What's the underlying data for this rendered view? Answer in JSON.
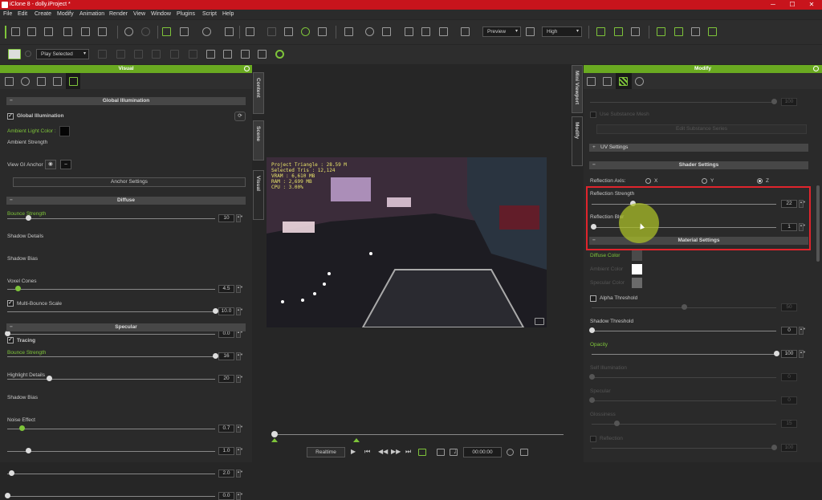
{
  "window": {
    "title": "iClone 8 - dolly.iProject *",
    "min": "─",
    "max": "☐",
    "close": "✕"
  },
  "menu": [
    "File",
    "Edit",
    "Create",
    "Modify",
    "Animation",
    "Render",
    "View",
    "Window",
    "Plugins",
    "Script",
    "Help"
  ],
  "toolbar": {
    "preview_mode": "Preview",
    "quality": "High",
    "play_mode": "Play Selected",
    "chevron": "▾"
  },
  "left_panel": {
    "title": "Visual",
    "gi": {
      "section": "Global Illumination",
      "checkbox_label": "Global Illumination",
      "checked": "✓",
      "ambient_color_label": "Ambient Light Color :",
      "ambient_color": "#050505",
      "ambient_strength_label": "Ambient Strength",
      "ambient_strength": "10",
      "ambient_strength_fraction": 0.1,
      "view_anchor_label": "View GI Anchor",
      "anchor_settings": "Anchor Settings"
    },
    "diffuse": {
      "section": "Diffuse",
      "bounce_label": "Bounce Strength",
      "bounce_value": "4.5",
      "bounce_fraction": 0.05,
      "shadow_details_label": "Shadow Details",
      "shadow_details_value": "10.0",
      "shadow_details_fraction": 1.0,
      "shadow_bias_label": "Shadow Bias",
      "shadow_bias_value": "0.0",
      "shadow_bias_fraction": 0.0,
      "voxel_label": "Voxel Cones",
      "voxel_value": "16",
      "voxel_fraction": 1.0,
      "multibounce_label": "Multi-Bounce Scale",
      "multibounce_value": "20",
      "multibounce_fraction": 0.2
    },
    "specular": {
      "section": "Specular",
      "tracing_label": "Tracing",
      "bounce_label": "Bounce Strength",
      "bounce_value": "0.7",
      "bounce_fraction": 0.07,
      "highlight_label": "Highlight Details",
      "highlight_value": "1.0",
      "highlight_fraction": 0.1,
      "shadow_bias_label": "Shadow Bias",
      "shadow_bias_value": "2.0",
      "shadow_bias_fraction": 0.02,
      "noise_label": "Noise Effect",
      "noise_value": "0.0",
      "noise_fraction": 0.0
    }
  },
  "side_tabs_left": [
    "Content",
    "Scene",
    "Visual"
  ],
  "side_tabs_right": [
    "Mini Viewport",
    "Modify"
  ],
  "viewport": {
    "hud": [
      "Project Triangle : 28.59 M",
      "Selected Tris : 12,124",
      "VRAM : 6,610 MB",
      "RAM : 2,699 MB",
      "CPU : 3.00%"
    ]
  },
  "playback": {
    "realtime": "Realtime",
    "timecode": "00:00:00"
  },
  "right_panel": {
    "title": "Modify",
    "faded": {
      "use_substance": "Use Substance Mesh",
      "edit_substance": "Edit Substance Series",
      "value_top": "100"
    },
    "uv_settings": "UV Settings",
    "shader": {
      "section": "Shader Settings",
      "axis_label": "Reflection Axis:",
      "axes": [
        "X",
        "Y",
        "Z"
      ],
      "selected_axis": "Z",
      "strength_label": "Reflection Strength",
      "strength_value": "22",
      "strength_fraction": 0.22,
      "blur_label": "Reflection Blur",
      "blur_value": "1",
      "blur_fraction": 0.01
    },
    "material": {
      "section": "Material Settings",
      "diffuse_label": "Diffuse Color",
      "diffuse_color": "#4a4a4a",
      "ambient_label": "Ambient Color",
      "ambient_color": "#ffffff",
      "specular_label": "Specular Color",
      "specular_color": "#6a6a6a",
      "alpha_label": "Alpha Threshold",
      "alpha_value": "50",
      "alpha_fraction": 0.5,
      "shadow_threshold_label": "Shadow Threshold",
      "shadow_threshold_value": "0",
      "shadow_threshold_fraction": 0.0,
      "opacity_label": "Opacity",
      "opacity_value": "100",
      "opacity_fraction": 1.0,
      "self_illum_label": "Self Illumination",
      "self_illum_value": "0",
      "specular_lbl": "Specular",
      "specular_value": "0",
      "glossiness_label": "Glossiness",
      "glossiness_value": "15",
      "reflection_label": "Reflection",
      "reflection_value": "100"
    }
  },
  "colors": {
    "accent": "#7ec43a",
    "titlebar": "#c8141c",
    "highlight_box": "#e0242c"
  }
}
